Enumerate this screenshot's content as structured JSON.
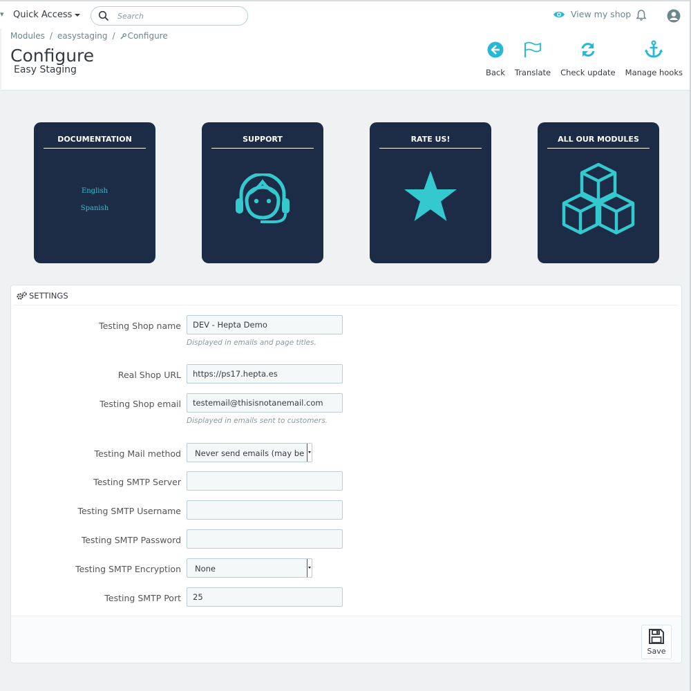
{
  "topbar": {
    "quick_access": "Quick Access",
    "search_placeholder": "Search",
    "view_shop": "View my shop",
    "icons": [
      "search-icon",
      "eye-icon",
      "bell-icon",
      "account-icon"
    ]
  },
  "header": {
    "breadcrumb": [
      "Modules",
      "easystaging",
      "Configure"
    ],
    "title": "Configure",
    "subtitle": "Easy Staging",
    "toolbar": [
      {
        "label": "Back",
        "icon": "arrow-left-circle-icon"
      },
      {
        "label": "Translate",
        "icon": "flag-icon"
      },
      {
        "label": "Check update",
        "icon": "refresh-icon"
      },
      {
        "label": "Manage hooks",
        "icon": "anchor-icon"
      }
    ]
  },
  "cards": [
    {
      "title": "DOCUMENTATION",
      "links": [
        "English",
        "Spanish"
      ]
    },
    {
      "title": "SUPPORT",
      "icon": "headset-icon"
    },
    {
      "title": "RATE US!",
      "icon": "star-icon"
    },
    {
      "title": "ALL OUR MODULES",
      "icon": "cubes-icon"
    }
  ],
  "colors": {
    "card_bg": "#1c2b46",
    "accent": "#25b9d7",
    "card_icon": "#33c9cf"
  },
  "settings": {
    "title": "SETTINGS",
    "fields": [
      {
        "label": "Testing Shop name",
        "value": "DEV - Hepta Demo",
        "help": "Displayed in emails and page titles."
      },
      {
        "label": "Real Shop URL",
        "value": "https://ps17.hepta.es"
      },
      {
        "label": "Testing Shop email",
        "value": "testemail@thisisnotanemail.com",
        "help": "Displayed in emails sent to customers."
      },
      {
        "label": "Testing Mail method",
        "value": "Never send emails (may be usef"
      },
      {
        "label": "Testing SMTP Server",
        "value": ""
      },
      {
        "label": "Testing SMTP Username",
        "value": ""
      },
      {
        "label": "Testing SMTP Password",
        "value": ""
      },
      {
        "label": "Testing SMTP Encryption",
        "value": "None"
      },
      {
        "label": "Testing SMTP Port",
        "value": "25"
      }
    ],
    "save_label": "Save"
  }
}
